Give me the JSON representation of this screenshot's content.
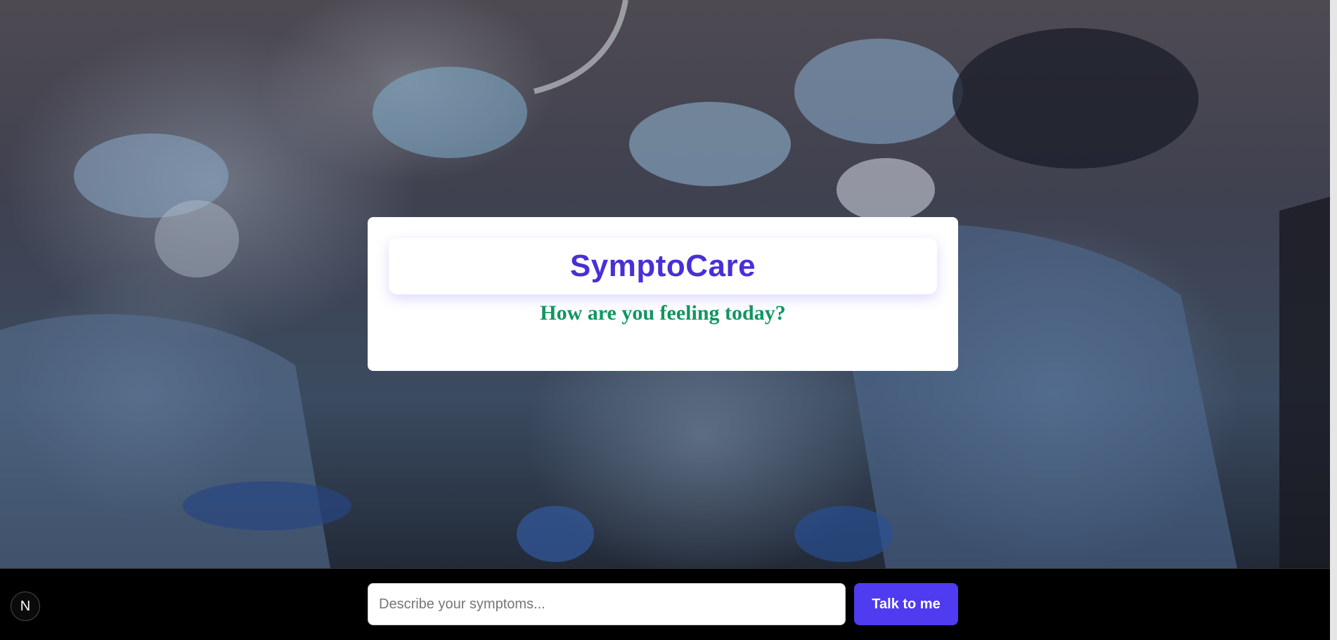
{
  "background": {
    "image_subject": "surgical team in operating room",
    "tint": "#3f4150"
  },
  "card": {
    "title": "SymptoCare",
    "subtitle": "How are you feeling today?",
    "title_color": "#4a2fd6",
    "subtitle_color": "#12955f"
  },
  "composer": {
    "input_placeholder": "Describe your symptoms...",
    "input_value": "",
    "submit_label": "Talk to me",
    "submit_color": "#4f3bf0"
  },
  "dev_badge": {
    "icon": "next-logo-icon",
    "glyph": "N"
  }
}
